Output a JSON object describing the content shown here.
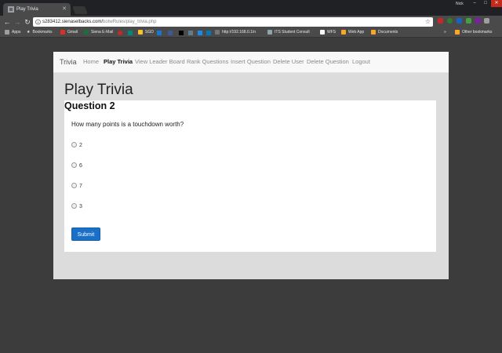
{
  "browser": {
    "tab_title": "Play Trivia",
    "user_name": "Nick",
    "url_host": "s283412.sienaselbacks.com/",
    "url_path": "botwRules/play_trivia.php",
    "colors": {
      "frame": "#202124",
      "toolbar": "#4a4a4a",
      "close": "#c42b1c"
    }
  },
  "bookmarks": {
    "items": [
      "Apps",
      "Bookmarks",
      "Gmail",
      "Siena E-Mail",
      "SGD",
      "http://192.168.0.1/n",
      "ITS Student Consult",
      "WFS",
      "Web App",
      "Documents"
    ],
    "overflow": "»",
    "other": "Other bookmarks"
  },
  "navbar": {
    "brand": "Trivia",
    "links": [
      {
        "label": "Home"
      },
      {
        "label": "Play Trivia",
        "active": true
      },
      {
        "label": "View Leader Board"
      },
      {
        "label": "Rank Questions"
      },
      {
        "label": "Insert Question"
      },
      {
        "label": "Delete User"
      },
      {
        "label": "Delete Question"
      },
      {
        "label": "Logout"
      }
    ]
  },
  "main": {
    "title": "Play Trivia",
    "question_heading": "Question 2",
    "question_text": "How many points is a touchdown worth?",
    "options": [
      "2",
      "6",
      "7",
      "3"
    ],
    "submit_label": "Submit"
  },
  "colors": {
    "primary": "#1a6fc9",
    "page_bg": "#dcdcdc",
    "navbar_bg": "#f8f8f8"
  }
}
